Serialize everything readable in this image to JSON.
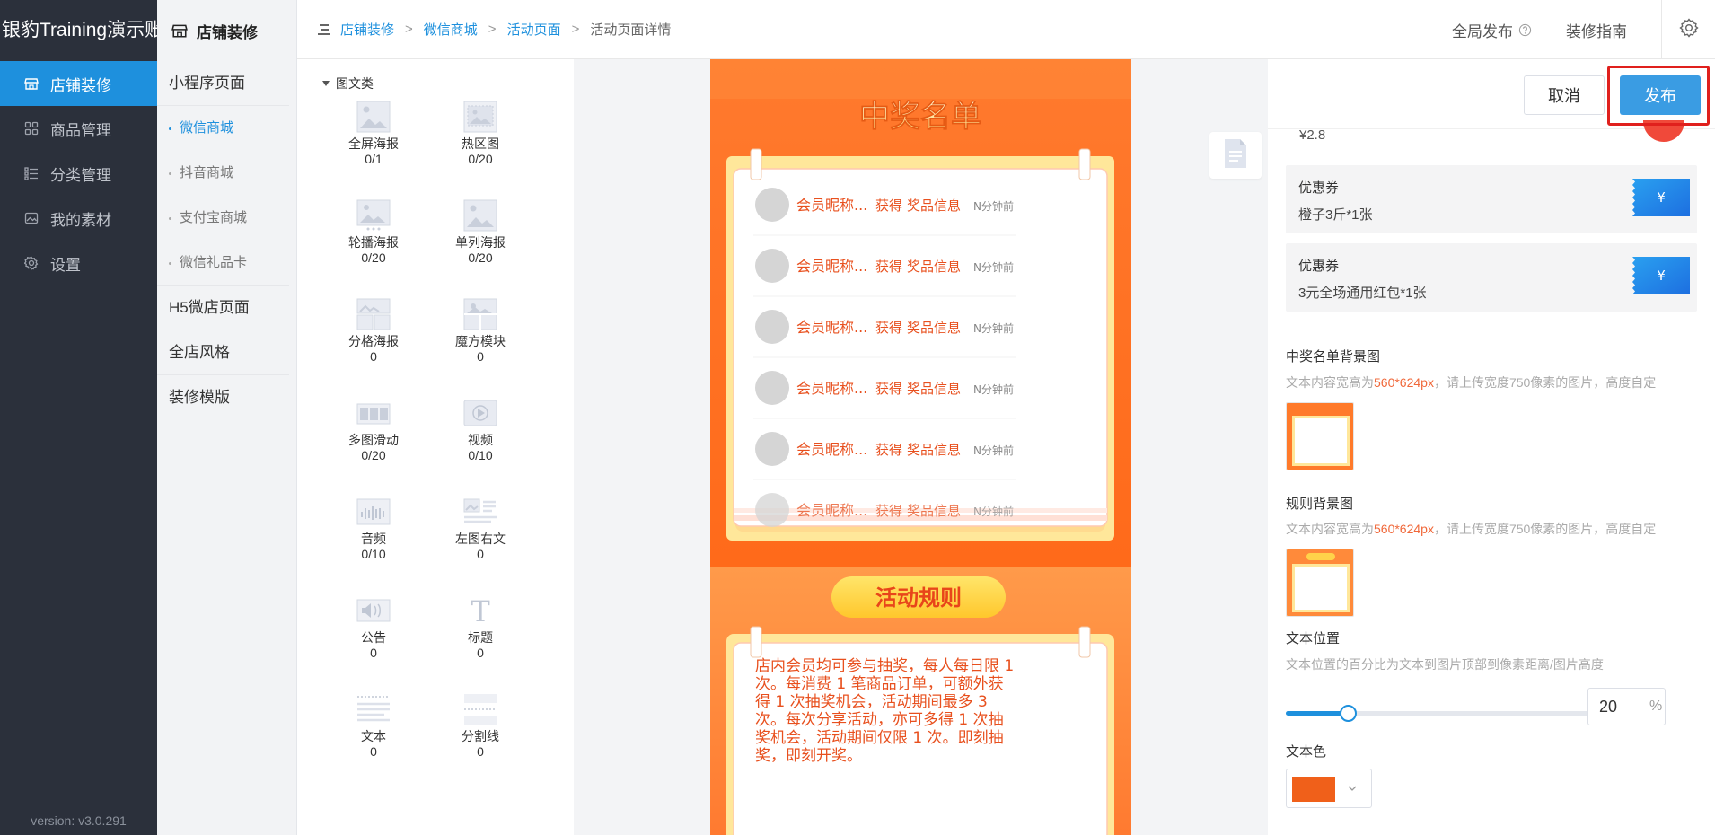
{
  "sidebar": {
    "brand": "银豹Training演示账号",
    "items": [
      {
        "label": "店铺装修",
        "icon": "shop-icon"
      },
      {
        "label": "商品管理",
        "icon": "grid-icon"
      },
      {
        "label": "分类管理",
        "icon": "list-icon"
      },
      {
        "label": "我的素材",
        "icon": "image-icon"
      },
      {
        "label": "设置",
        "icon": "gear-icon"
      }
    ],
    "version": "version: v3.0.291"
  },
  "subnav": {
    "title": "店铺装修",
    "miniprogram": "小程序页面",
    "subs": [
      "微信商城",
      "抖音商城",
      "支付宝商城",
      "微信礼品卡"
    ],
    "h5": "H5微店页面",
    "style": "全店风格",
    "template": "装修模版"
  },
  "breadcrumb": [
    "店铺装修",
    "微信商城",
    "活动页面",
    "活动页面详情"
  ],
  "breadcrumb_sep": ">",
  "topbar": {
    "publish_all": "全局发布",
    "guide": "装修指南"
  },
  "components": {
    "category": "图文类",
    "items": [
      {
        "name": "全屏海报",
        "count": "0/1"
      },
      {
        "name": "热区图",
        "count": "0/20"
      },
      {
        "name": "轮播海报",
        "count": "0/20"
      },
      {
        "name": "单列海报",
        "count": "0/20"
      },
      {
        "name": "分格海报",
        "count": "0"
      },
      {
        "name": "魔方模块",
        "count": "0"
      },
      {
        "name": "多图滑动",
        "count": "0/20"
      },
      {
        "name": "视频",
        "count": "0/10"
      },
      {
        "name": "音频",
        "count": "0/10"
      },
      {
        "name": "左图右文",
        "count": "0"
      },
      {
        "name": "公告",
        "count": "0"
      },
      {
        "name": "标题",
        "count": "0"
      },
      {
        "name": "文本",
        "count": "0"
      },
      {
        "name": "分割线",
        "count": "0"
      }
    ]
  },
  "phone": {
    "winners_title": "中奖名单",
    "winners": [
      {
        "name": "会员昵称...",
        "got": "获得",
        "prize": "奖品信息",
        "time": "N分钟前"
      },
      {
        "name": "会员昵称...",
        "got": "获得",
        "prize": "奖品信息",
        "time": "N分钟前"
      },
      {
        "name": "会员昵称...",
        "got": "获得",
        "prize": "奖品信息",
        "time": "N分钟前"
      },
      {
        "name": "会员昵称...",
        "got": "获得",
        "prize": "奖品信息",
        "time": "N分钟前"
      },
      {
        "name": "会员昵称...",
        "got": "获得",
        "prize": "奖品信息",
        "time": "N分钟前"
      },
      {
        "name": "会员昵称...",
        "got": "获得",
        "prize": "奖品信息",
        "time": "N分钟前"
      }
    ],
    "rules_title": "活动规则",
    "rules_text": "店内会员均可参与抽奖，每人每日限 1 次。每消费 1 笔商品订单，可额外获得 1 次抽奖机会，活动期间最多 3 次。每次分享活动，亦可多得 1 次抽奖机会，活动期间仅限 1 次。即刻抽奖，即刻开奖。"
  },
  "actions": {
    "cancel": "取消",
    "publish": "发布"
  },
  "settings": {
    "partial_price": "¥2.8",
    "coupons": [
      {
        "type": "优惠券",
        "desc": "橙子3斤*1张",
        "symbol": "¥"
      },
      {
        "type": "优惠券",
        "desc": "3元全场通用红包*1张",
        "symbol": "¥"
      }
    ],
    "winners_bg": {
      "label": "中奖名单背景图",
      "hint_pre": "文本内容宽高为",
      "hint_size": "560*624px",
      "hint_post": "，请上传宽度750像素的图片，高度自定"
    },
    "rules_bg": {
      "label": "规则背景图",
      "hint_pre": "文本内容宽高为",
      "hint_size": "560*624px",
      "hint_post": "，请上传宽度750像素的图片，高度自定"
    },
    "text_pos": {
      "label": "文本位置",
      "hint": "文本位置的百分比为文本到图片顶部到像素距离/图片高度",
      "value": "20",
      "unit": "%",
      "percent": 20
    },
    "text_color": {
      "label": "文本色",
      "color": "#f0601a"
    }
  },
  "colors": {
    "accent": "#1e90dd",
    "orange": "#ff7b2d",
    "highlight": "#f0683a",
    "outline": "#e0201d"
  }
}
